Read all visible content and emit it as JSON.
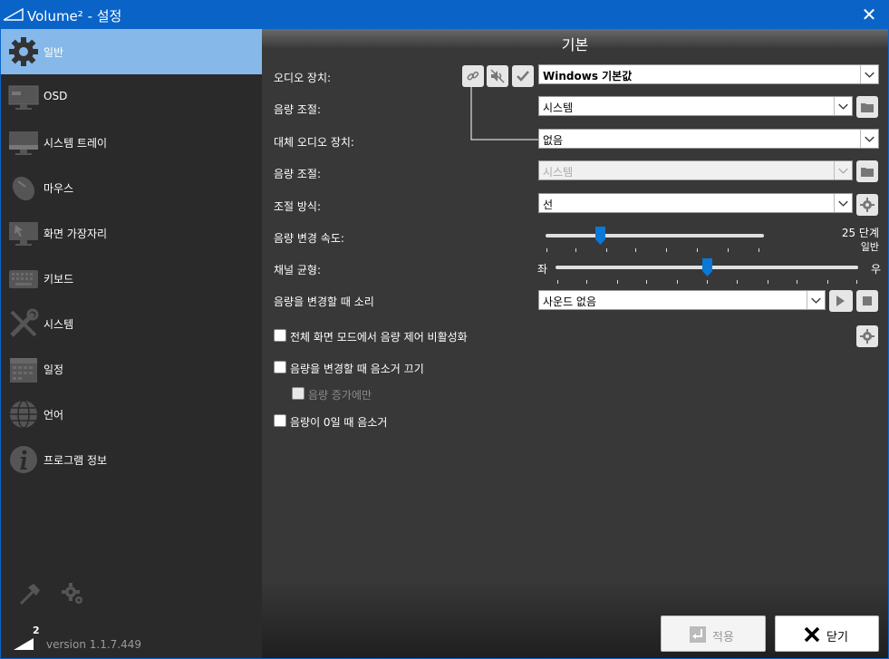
{
  "window": {
    "title": "Volume² - 설정"
  },
  "sidebar": {
    "items": [
      {
        "label": "일반",
        "icon": "gear-icon"
      },
      {
        "label": "OSD",
        "icon": "monitor-icon"
      },
      {
        "label": "시스템 트레이",
        "icon": "tray-icon"
      },
      {
        "label": "마우스",
        "icon": "mouse-icon"
      },
      {
        "label": "화면 가장자리",
        "icon": "screen-edge-icon"
      },
      {
        "label": "키보드",
        "icon": "keyboard-icon"
      },
      {
        "label": "시스템",
        "icon": "tools-icon"
      },
      {
        "label": "일정",
        "icon": "calendar-icon"
      },
      {
        "label": "언어",
        "icon": "globe-icon"
      },
      {
        "label": "프로그램 정보",
        "icon": "info-icon"
      }
    ],
    "version": "version 1.1.7.449",
    "logo_number": "2"
  },
  "main": {
    "title": "기본",
    "audio_device": {
      "label": "오디오 장치:",
      "value": "Windows 기본값"
    },
    "volume_control": {
      "label": "음량 조절:",
      "value": "시스템"
    },
    "alt_audio_device": {
      "label": "대체 오디오 장치:",
      "value": "없음"
    },
    "alt_volume_control": {
      "label": "음량 조절:",
      "value": "시스템"
    },
    "control_method": {
      "label": "조절 방식:",
      "value": "선"
    },
    "volume_speed": {
      "label": "음량 변경 속도:",
      "value_text": "25 단계",
      "sub_text": "일반",
      "level": 0.25
    },
    "channel_balance": {
      "label": "채널 균형:",
      "left": "좌",
      "right": "우",
      "level": 0.5
    },
    "change_sound": {
      "label": "음량을 변경할 때 소리",
      "value": "사운드 없음"
    },
    "checkboxes": {
      "fullscreen": "전체 화면 모드에서 음량 제어 비활성화",
      "mute_on_change": "음량을 변경할 때 음소거 끄기",
      "increase_only": "음량 증가에만",
      "mute_at_zero": "음량이 0일 때 음소거"
    }
  },
  "footer": {
    "apply": "적용",
    "close": "닫기"
  }
}
